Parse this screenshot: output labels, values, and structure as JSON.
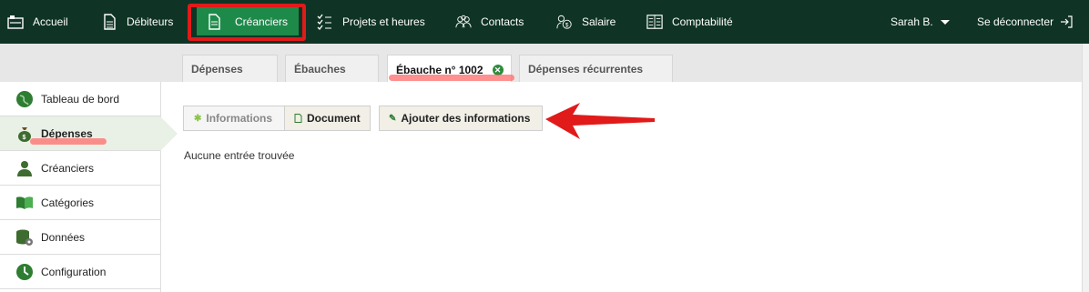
{
  "topnav": {
    "items": [
      {
        "label": "Accueil",
        "icon": "home-icon"
      },
      {
        "label": "Débiteurs",
        "icon": "document-icon"
      },
      {
        "label": "Créanciers",
        "icon": "document-icon",
        "active": true
      },
      {
        "label": "Projets et heures",
        "icon": "checklist-icon"
      },
      {
        "label": "Contacts",
        "icon": "people-icon"
      },
      {
        "label": "Salaire",
        "icon": "salary-icon"
      },
      {
        "label": "Comptabilité",
        "icon": "ledger-icon"
      }
    ],
    "user": "Sarah B.",
    "logout": "Se déconnecter"
  },
  "tabs": [
    {
      "label": "Dépenses"
    },
    {
      "label": "Ébauches"
    },
    {
      "label": "Ébauche n° 1002",
      "active": true
    },
    {
      "label": "Dépenses récurrentes"
    }
  ],
  "sidebar": {
    "items": [
      {
        "label": "Tableau de bord",
        "icon": "globe-icon"
      },
      {
        "label": "Dépenses",
        "icon": "money-bag-icon",
        "active": true
      },
      {
        "label": "Créanciers",
        "icon": "user-icon"
      },
      {
        "label": "Catégories",
        "icon": "book-icon"
      },
      {
        "label": "Données",
        "icon": "database-icon"
      },
      {
        "label": "Configuration",
        "icon": "clock-icon"
      }
    ]
  },
  "content": {
    "btn_informations": "Informations",
    "btn_document": "Document",
    "btn_add": "Ajouter des informations",
    "empty_text": "Aucune entrée trouvée"
  },
  "colors": {
    "nav_bg": "#0f3425",
    "nav_active": "#1e8a4a",
    "annotation_red": "#e11a1a"
  }
}
